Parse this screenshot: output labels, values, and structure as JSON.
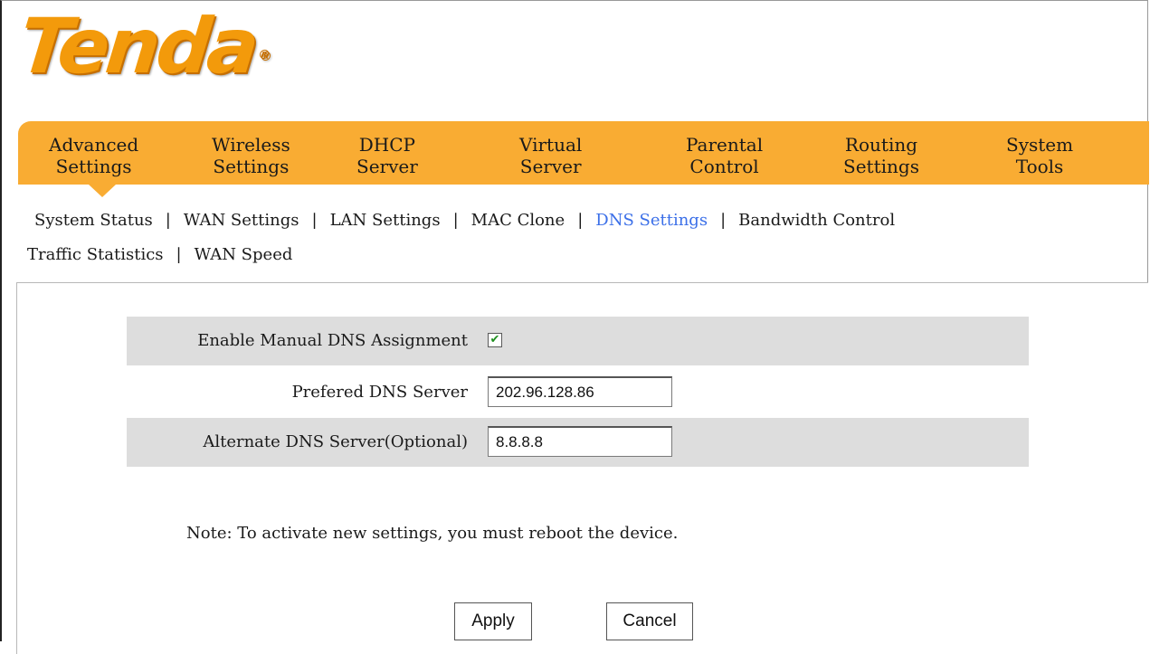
{
  "brand": {
    "logo_text": "Tenda",
    "registered_mark": "®"
  },
  "main_nav": [
    {
      "line1": "Advanced",
      "line2": "Settings"
    },
    {
      "line1": "Wireless",
      "line2": "Settings"
    },
    {
      "line1": "DHCP",
      "line2": "Server"
    },
    {
      "line1": "Virtual",
      "line2": "Server"
    },
    {
      "line1": "Parental",
      "line2": "Control"
    },
    {
      "line1": "Routing",
      "line2": "Settings"
    },
    {
      "line1": "System",
      "line2": "Tools"
    }
  ],
  "sub_nav": {
    "items": [
      "System Status",
      "WAN Settings",
      "LAN Settings",
      "MAC Clone",
      "DNS Settings",
      "Bandwidth Control",
      "Traffic Statistics",
      "WAN Speed"
    ],
    "separator": "|",
    "active": "DNS Settings"
  },
  "form": {
    "enable_label": "Enable Manual DNS Assignment",
    "enable_checked": true,
    "check_glyph": "✔",
    "preferred_label": "Prefered DNS Server",
    "preferred_value": "202.96.128.86",
    "alternate_label": "Alternate DNS Server(Optional)",
    "alternate_value": "8.8.8.8"
  },
  "note": "Note: To activate new settings, you must reboot the device.",
  "buttons": {
    "apply": "Apply",
    "cancel": "Cancel"
  },
  "colors": {
    "nav_orange": "#f9ac33",
    "logo_orange": "#f39a0b",
    "active_link": "#3b6fe8",
    "row_shade": "#dddddd"
  }
}
